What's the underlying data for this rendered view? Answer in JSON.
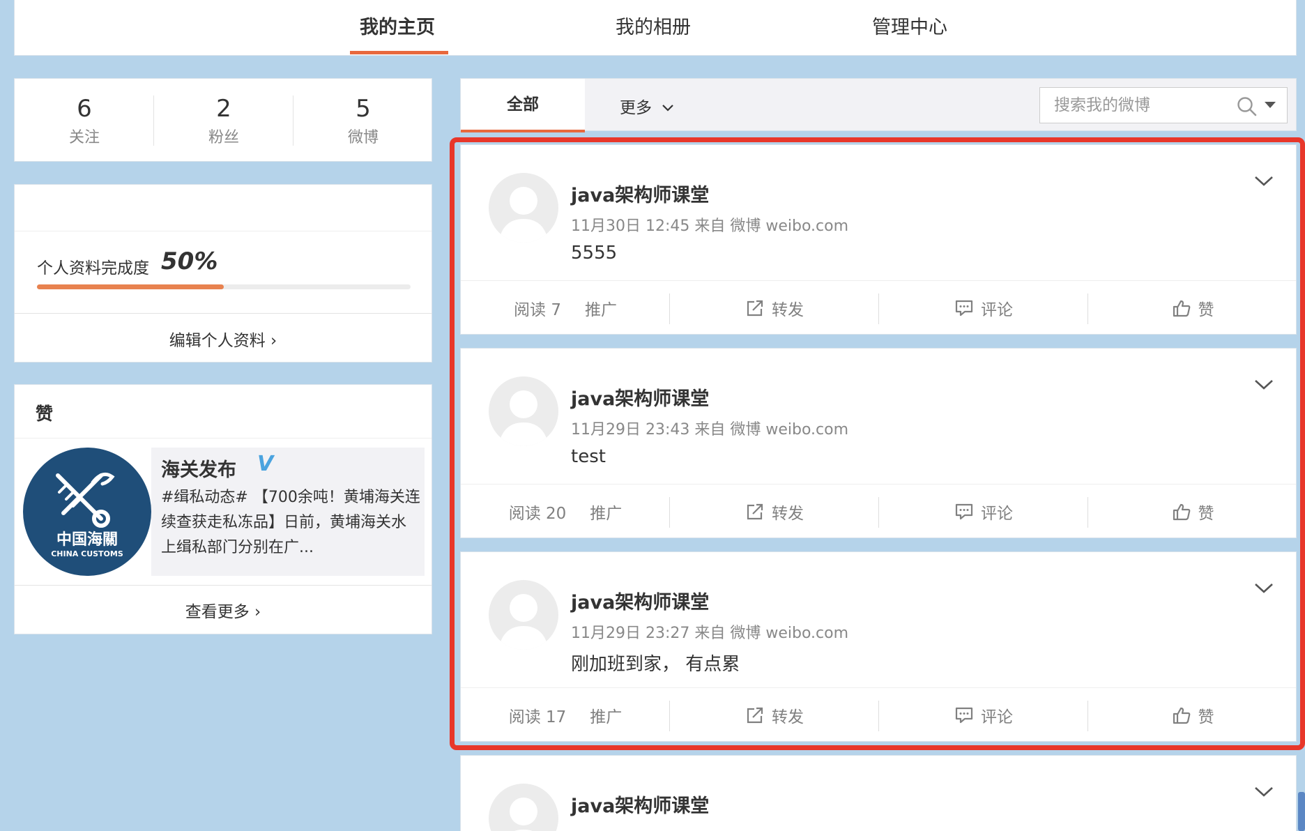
{
  "nav": {
    "tabs": [
      {
        "label": "我的主页"
      },
      {
        "label": "我的相册"
      },
      {
        "label": "管理中心"
      }
    ]
  },
  "stats": [
    {
      "num": "6",
      "label": "关注"
    },
    {
      "num": "2",
      "label": "粉丝"
    },
    {
      "num": "5",
      "label": "微博"
    }
  ],
  "profile": {
    "progress_label": "个人资料完成度",
    "progress_text": "50%",
    "progress_fraction": 0.5,
    "progress_color": "#e8824f",
    "edit_label": "编辑个人资料 ›"
  },
  "likes": {
    "header": "赞",
    "account_name": "海关发布",
    "verified_mark": "V",
    "description": "#缉私动态# 【700余吨！黄埔海关连续查获走私冻品】日前，黄埔海关水上缉私部门分别在广...",
    "logo_text_cn": "中国海關",
    "logo_text_en": "CHINA CUSTOMS",
    "more_label": "查看更多 ›"
  },
  "feed": {
    "tab_all": "全部",
    "more": "更多",
    "search_placeholder": "搜索我的微博",
    "posts": [
      {
        "author": "java架构师课堂",
        "meta": "11月30日 12:45 来自 微博 weibo.com",
        "content": "5555",
        "reads": "阅读 7",
        "promote": "推广",
        "repost": "转发",
        "comment": "评论",
        "like": "赞"
      },
      {
        "author": "java架构师课堂",
        "meta": "11月29日 23:43 来自 微博 weibo.com",
        "content": "test",
        "reads": "阅读 20",
        "promote": "推广",
        "repost": "转发",
        "comment": "评论",
        "like": "赞"
      },
      {
        "author": "java架构师课堂",
        "meta": "11月29日 23:27 来自 微博 weibo.com",
        "content": "刚加班到家， 有点累",
        "reads": "阅读 17",
        "promote": "推广",
        "repost": "转发",
        "comment": "评论",
        "like": "赞"
      },
      {
        "author": "java架构师课堂"
      }
    ]
  },
  "colors": {
    "accent": "#e8683d",
    "highlight": "#e8372a",
    "background": "#b5d3ea"
  }
}
